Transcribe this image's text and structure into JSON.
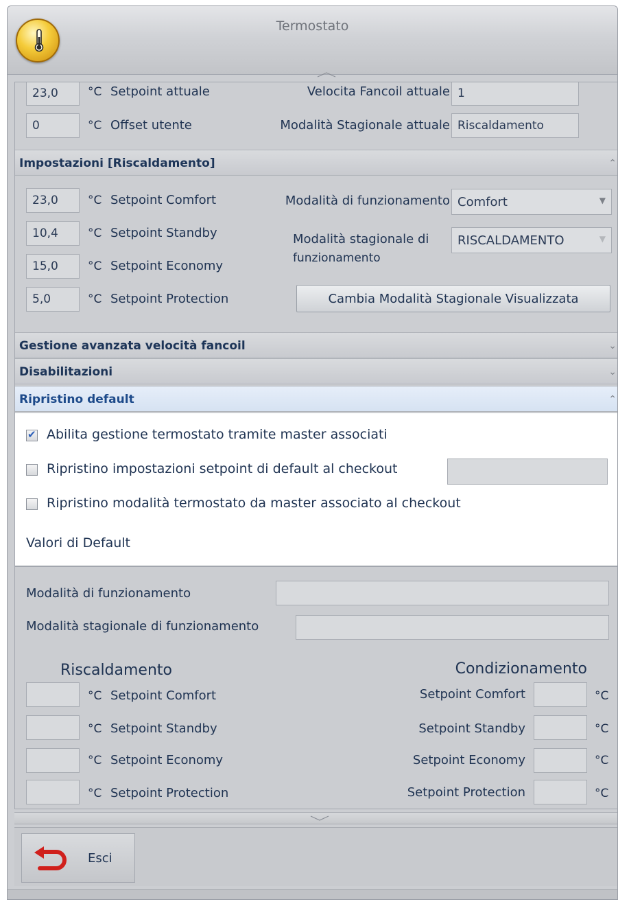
{
  "window": {
    "title": "Termostato"
  },
  "current": {
    "setpoint_value": "23,0",
    "offset_value": "0",
    "unit": "°C",
    "setpoint_label": "Setpoint attuale",
    "offset_label": "Offset utente",
    "fan_speed_label": "Velocita Fancoil attuale",
    "fan_speed_value": "1",
    "seasonal_mode_label": "Modalità Stagionale attuale",
    "seasonal_mode_value": "Riscaldamento"
  },
  "settings": {
    "title": "Impostazioni [Riscaldamento]",
    "icon": "double-chevron-up-icon",
    "rows": [
      {
        "value": "23,0",
        "unit": "°C",
        "label": "Setpoint Comfort"
      },
      {
        "value": "10,4",
        "unit": "°C",
        "label": "Setpoint Standby"
      },
      {
        "value": "15,0",
        "unit": "°C",
        "label": "Setpoint Economy"
      },
      {
        "value": "5,0",
        "unit": "°C",
        "label": "Setpoint Protection"
      }
    ],
    "operating_mode_label": "Modalità di funzionamento",
    "operating_mode_value": "Comfort",
    "seasonal_mode_label_line1": "Modalità stagionale di",
    "seasonal_mode_label_line2": "funzionamento",
    "seasonal_mode_value": "RISCALDAMENTO",
    "change_button": "Cambia Modalità Stagionale Visualizzata"
  },
  "sections": {
    "fancoil": "Gestione avanzata velocità fancoil",
    "disabilitazioni": "Disabilitazioni",
    "ripristino": "Ripristino default"
  },
  "ripristino": {
    "options": [
      {
        "label": "Abilita gestione termostato tramite master associati",
        "checked": true
      },
      {
        "label": "Ripristino impostazioni setpoint di default al checkout",
        "checked": false
      },
      {
        "label": "Ripristino modalità termostato da master associato al checkout",
        "checked": false
      }
    ],
    "defaults_heading": "Valori di Default"
  },
  "defaults": {
    "operating_mode_label": "Modalità di funzionamento",
    "seasonal_mode_label": "Modalità stagionale di funzionamento",
    "heating_title": "Riscaldamento",
    "cooling_title": "Condizionamento",
    "unit": "°C",
    "labels": [
      "Setpoint Comfort",
      "Setpoint Standby",
      "Setpoint Economy",
      "Setpoint Protection"
    ]
  },
  "footer": {
    "exit_label": "Esci"
  },
  "colors": {
    "accent_blue": "#1d4a8a",
    "exit_icon_red": "#d0201c",
    "app_icon_gold": "#f5cc3a"
  }
}
